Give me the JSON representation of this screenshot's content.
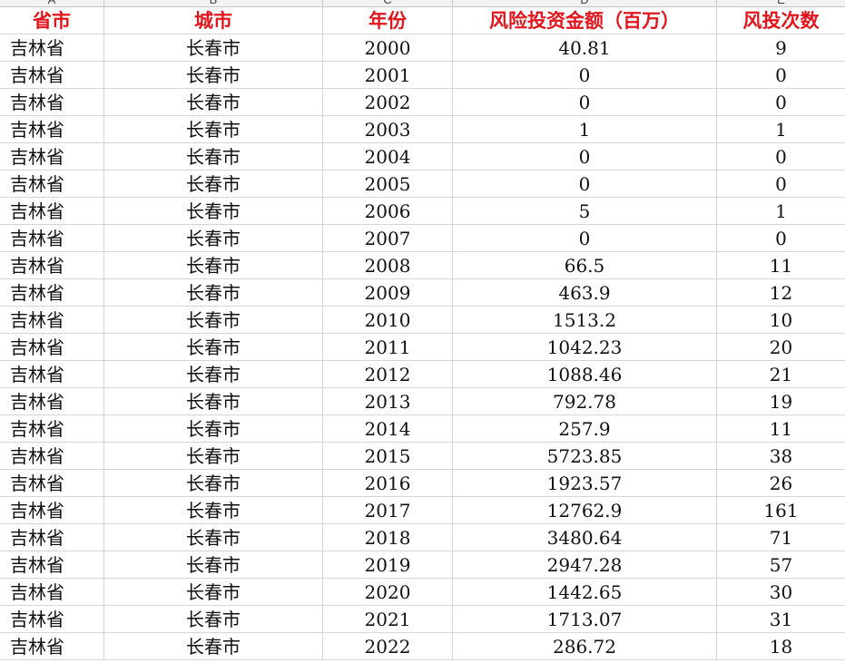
{
  "column_letters": [
    "A",
    "B",
    "C",
    "D",
    "E"
  ],
  "headers": [
    "省市",
    "城市",
    "年份",
    "风险投资金额（百万）",
    "风投次数"
  ],
  "rows": [
    [
      "吉林省",
      "长春市",
      "2000",
      "40.81",
      "9"
    ],
    [
      "吉林省",
      "长春市",
      "2001",
      "0",
      "0"
    ],
    [
      "吉林省",
      "长春市",
      "2002",
      "0",
      "0"
    ],
    [
      "吉林省",
      "长春市",
      "2003",
      "1",
      "1"
    ],
    [
      "吉林省",
      "长春市",
      "2004",
      "0",
      "0"
    ],
    [
      "吉林省",
      "长春市",
      "2005",
      "0",
      "0"
    ],
    [
      "吉林省",
      "长春市",
      "2006",
      "5",
      "1"
    ],
    [
      "吉林省",
      "长春市",
      "2007",
      "0",
      "0"
    ],
    [
      "吉林省",
      "长春市",
      "2008",
      "66.5",
      "11"
    ],
    [
      "吉林省",
      "长春市",
      "2009",
      "463.9",
      "12"
    ],
    [
      "吉林省",
      "长春市",
      "2010",
      "1513.2",
      "10"
    ],
    [
      "吉林省",
      "长春市",
      "2011",
      "1042.23",
      "20"
    ],
    [
      "吉林省",
      "长春市",
      "2012",
      "1088.46",
      "21"
    ],
    [
      "吉林省",
      "长春市",
      "2013",
      "792.78",
      "19"
    ],
    [
      "吉林省",
      "长春市",
      "2014",
      "257.9",
      "11"
    ],
    [
      "吉林省",
      "长春市",
      "2015",
      "5723.85",
      "38"
    ],
    [
      "吉林省",
      "长春市",
      "2016",
      "1923.57",
      "26"
    ],
    [
      "吉林省",
      "长春市",
      "2017",
      "12762.9",
      "161"
    ],
    [
      "吉林省",
      "长春市",
      "2018",
      "3480.64",
      "71"
    ],
    [
      "吉林省",
      "长春市",
      "2019",
      "2947.28",
      "57"
    ],
    [
      "吉林省",
      "长春市",
      "2020",
      "1442.65",
      "30"
    ],
    [
      "吉林省",
      "长春市",
      "2021",
      "1713.07",
      "31"
    ],
    [
      "吉林省",
      "长春市",
      "2022",
      "286.72",
      "18"
    ]
  ],
  "colors": {
    "header_text": "#e3151c",
    "cell_text": "#111111",
    "gridline": "#d4d4d4",
    "column_header_bg": "#f2f2f2"
  }
}
